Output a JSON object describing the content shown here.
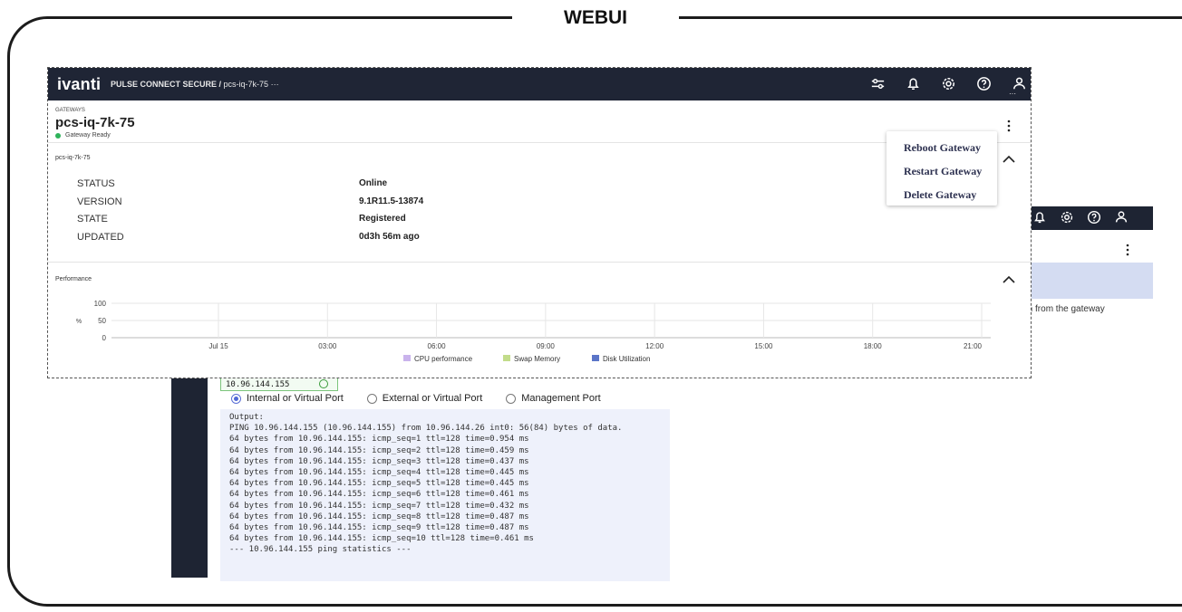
{
  "frame": {
    "title": "WEBUI"
  },
  "app": {
    "logo": "ivanti",
    "breadcrumb_product": "PULSE CONNECT SECURE /",
    "breadcrumb_item": "pcs-iq-7k-75",
    "breadcrumb_more": "···"
  },
  "gateway": {
    "kicker": "GATEWAYS",
    "name": "pcs-iq-7k-75",
    "status": "Gateway Ready",
    "status_color": "#2eb35a"
  },
  "details": {
    "section_title": "pcs-iq-7k-75",
    "rows": [
      {
        "key": "STATUS",
        "value": "Online"
      },
      {
        "key": "VERSION",
        "value": "9.1R11.5-13874"
      },
      {
        "key": "STATE",
        "value": "Registered"
      },
      {
        "key": "UPDATED",
        "value": "0d3h 56m ago"
      }
    ]
  },
  "menu": {
    "items": [
      "Reboot Gateway",
      "Restart Gateway",
      "Delete Gateway"
    ]
  },
  "performance": {
    "section_title": "Performance"
  },
  "chart_data": {
    "type": "line",
    "title": "",
    "xlabel": "",
    "ylabel": "%",
    "y_ticks": [
      "100",
      "50",
      "0"
    ],
    "ylim": [
      0,
      100
    ],
    "x_ticks": [
      "Jul 15",
      "03:00",
      "06:00",
      "09:00",
      "12:00",
      "15:00",
      "18:00",
      "21:00"
    ],
    "series": [
      {
        "name": "CPU performance",
        "color": "#c9b3ec",
        "values": []
      },
      {
        "name": "Swap Memory",
        "color": "#c2dc8a",
        "values": []
      },
      {
        "name": "Disk Utilization",
        "color": "#5b75c8",
        "values": []
      }
    ],
    "grid": true,
    "legend": "bottom"
  },
  "back_window": {
    "ip_value": "10.96.144.155",
    "note": "k path from the gateway",
    "ports": [
      {
        "label": "Internal or Virtual Port",
        "selected": true
      },
      {
        "label": "External or Virtual Port",
        "selected": false
      },
      {
        "label": "Management Port",
        "selected": false
      }
    ],
    "output_lines": [
      "Output:",
      "PING 10.96.144.155 (10.96.144.155) from 10.96.144.26 int0: 56(84) bytes of data.",
      "64 bytes from 10.96.144.155: icmp_seq=1 ttl=128 time=0.954 ms",
      "64 bytes from 10.96.144.155: icmp_seq=2 ttl=128 time=0.459 ms",
      "64 bytes from 10.96.144.155: icmp_seq=3 ttl=128 time=0.437 ms",
      "64 bytes from 10.96.144.155: icmp_seq=4 ttl=128 time=0.445 ms",
      "64 bytes from 10.96.144.155: icmp_seq=5 ttl=128 time=0.445 ms",
      "64 bytes from 10.96.144.155: icmp_seq=6 ttl=128 time=0.461 ms",
      "64 bytes from 10.96.144.155: icmp_seq=7 ttl=128 time=0.432 ms",
      "64 bytes from 10.96.144.155: icmp_seq=8 ttl=128 time=0.487 ms",
      "64 bytes from 10.96.144.155: icmp_seq=9 ttl=128 time=0.487 ms",
      "64 bytes from 10.96.144.155: icmp_seq=10 ttl=128 time=0.461 ms",
      "--- 10.96.144.155 ping statistics ---"
    ]
  },
  "icons": {
    "top": [
      "sliders-icon",
      "bell-icon",
      "gear-icon",
      "help-icon",
      "user-icon"
    ]
  },
  "colors": {
    "topbar": "#1f2535",
    "accent": "#4f68d6"
  }
}
